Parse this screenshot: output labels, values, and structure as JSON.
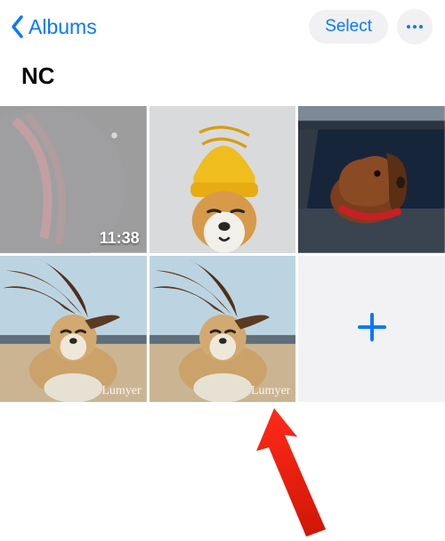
{
  "nav": {
    "back_label": "Albums",
    "select_label": "Select"
  },
  "album": {
    "title": "NC"
  },
  "grid": {
    "items": [
      {
        "type": "video",
        "duration": "11:38",
        "selected": true
      },
      {
        "type": "photo"
      },
      {
        "type": "photo"
      },
      {
        "type": "photo",
        "watermark": "Lumyer"
      },
      {
        "type": "photo",
        "watermark": "Lumyer"
      },
      {
        "type": "add"
      }
    ]
  },
  "colors": {
    "accent": "#0a78ff"
  }
}
